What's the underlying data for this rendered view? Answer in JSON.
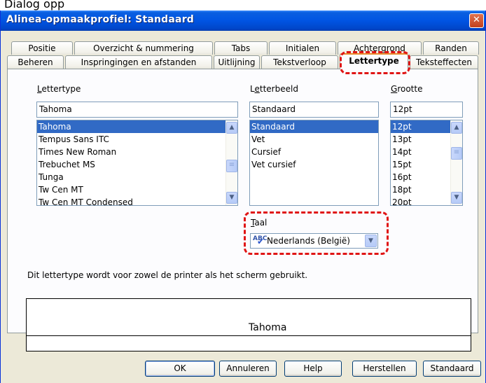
{
  "page_heading": "Dialog opp",
  "window": {
    "title": "Alinea-opmaakprofiel: Standaard",
    "close_label": "✕"
  },
  "tabs_row1": [
    "Positie",
    "Overzicht & nummering",
    "Tabs",
    "Initialen",
    "Achtergrond",
    "Randen"
  ],
  "tabs_row2": [
    "Beheren",
    "Inspringingen en afstanden",
    "Uitlijning",
    "Tekstverloop",
    "Lettertype",
    "Teksteffecten"
  ],
  "active_tab": "Lettertype",
  "font": {
    "label": "Lettertype",
    "label_accel": "L",
    "label_rest": "ettertype",
    "value": "Tahoma",
    "options": [
      "Tahoma",
      "Tempus Sans ITC",
      "Times New Roman",
      "Trebuchet MS",
      "Tunga",
      "Tw Cen MT",
      "Tw Cen MT Condensed"
    ],
    "selected": "Tahoma"
  },
  "style": {
    "label": "Letterbeeld",
    "label_pre": "L",
    "label_accel": "e",
    "label_rest": "tterbeeld",
    "value": "Standaard",
    "options": [
      "Standaard",
      "Vet",
      "Cursief",
      "Vet cursief"
    ],
    "selected": "Standaard"
  },
  "size": {
    "label": "Grootte",
    "label_accel": "G",
    "label_rest": "rootte",
    "value": "12pt",
    "options": [
      "12pt",
      "13pt",
      "14pt",
      "15pt",
      "16pt",
      "18pt",
      "20pt"
    ],
    "selected": "12pt"
  },
  "language": {
    "label": "Taal",
    "label_accel": "T",
    "label_rest": "aal",
    "icon_text": "ABC",
    "value": "Nederlands (België)"
  },
  "info_text": "Dit lettertype wordt voor zowel de printer als het scherm gebruikt.",
  "preview_text": "Tahoma",
  "buttons": {
    "ok": "OK",
    "cancel": "Annuleren",
    "help": "Help",
    "reset": "Herstellen",
    "standard": "Standaard"
  },
  "colors": {
    "title_bar": "#0054e3",
    "selection": "#316ac5",
    "highlight_dash": "#e01515",
    "active_tab_accent": "#e68b2c"
  }
}
